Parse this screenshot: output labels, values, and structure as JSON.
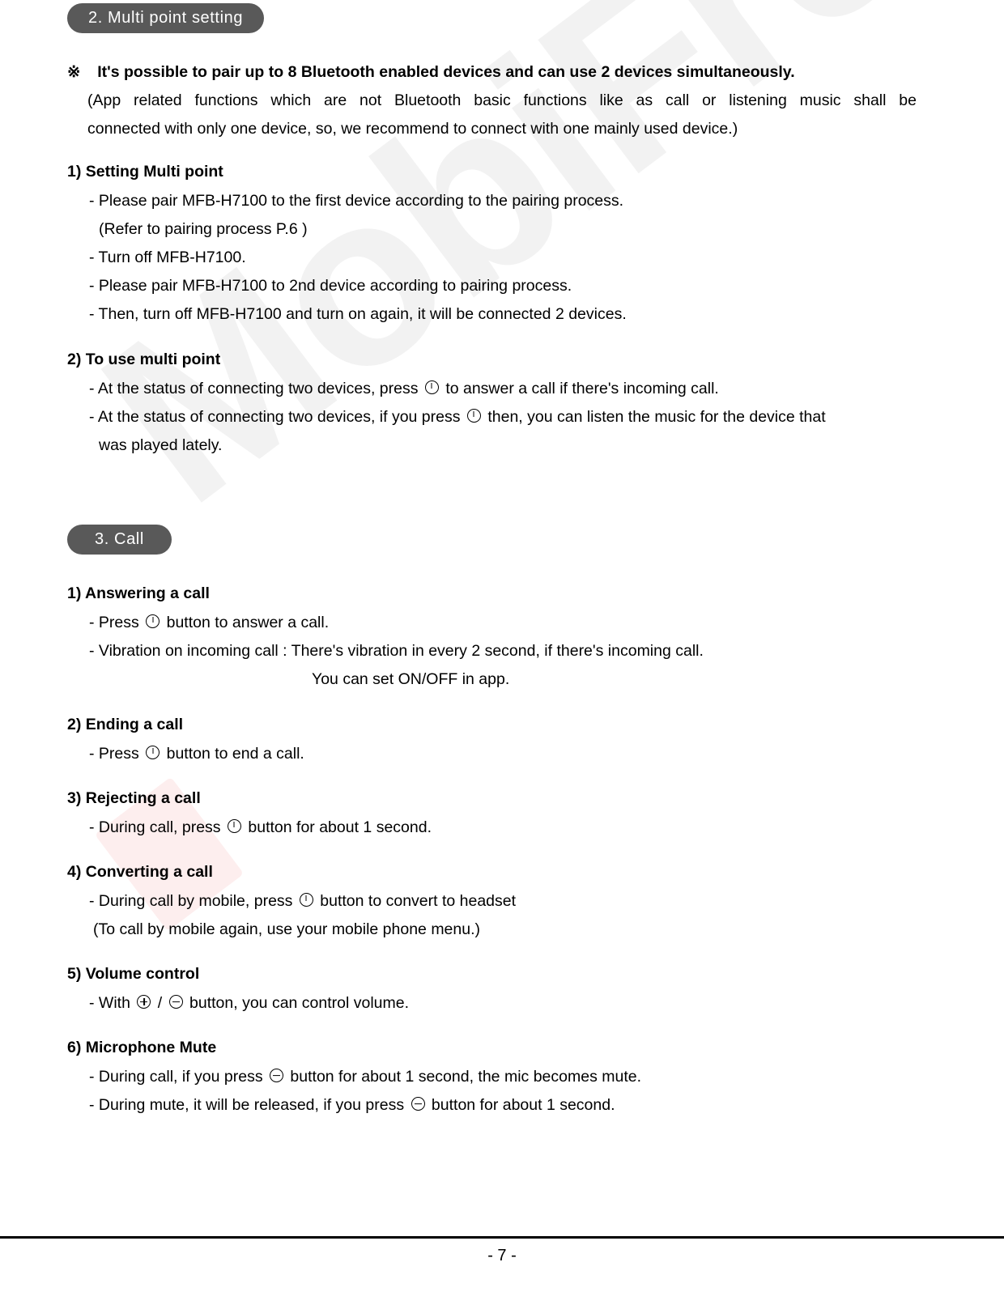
{
  "document": {
    "watermark": "MobiFren",
    "page_number": "- 7 -"
  },
  "sections": [
    {
      "tab_label": "2. Multi point setting",
      "note": {
        "marker": "※",
        "headline": "It's possible to pair up to 8 Bluetooth enabled devices and can use 2 devices simultaneously.",
        "paren_line1": "(App related functions which are not Bluetooth basic functions like as call or listening music shall be",
        "paren_line2": "connected with only one device, so, we recommend to connect with one mainly used device.)"
      },
      "items": [
        {
          "heading": "1) Setting Multi point",
          "lines": [
            "- Please pair MFB-H7100 to the first device according to the pairing process.",
            "(Refer to pairing process P.6 )",
            "- Turn off MFB-H7100.",
            "- Please pair MFB-H7100 to 2nd device according to pairing process.",
            "- Then, turn off MFB-H7100 and turn on again, it will be connected 2 devices."
          ]
        },
        {
          "heading": "2) To use multi point",
          "line1_a": "- At the status of connecting two devices, press",
          "line1_icon": "mfb-button-icon",
          "line1_b": "to answer a call if there's incoming call.",
          "line2_a": "- At the status of connecting two devices, if you press",
          "line2_icon": "mfb-button-icon",
          "line2_b": "then, you can listen the music for the device that",
          "line3": "was played lately."
        }
      ]
    },
    {
      "tab_label": "3. Call",
      "items": [
        {
          "heading": "1) Answering a call",
          "line1_a": "- Press",
          "line1_icon": "mfb-button-icon",
          "line1_b": "button to answer a call.",
          "line2": "- Vibration on incoming call : There's vibration in every 2 second, if there's incoming call.",
          "line3": "You can set ON/OFF in app."
        },
        {
          "heading": "2) Ending a call",
          "line1_a": "- Press",
          "line1_icon": "mfb-button-icon",
          "line1_b": "button to end a call."
        },
        {
          "heading": "3) Rejecting a call",
          "line1_a": "- During call, press",
          "line1_icon": "mfb-button-icon",
          "line1_b": "button for about 1 second."
        },
        {
          "heading": "4) Converting a call",
          "line1_a": "- During call by mobile, press",
          "line1_icon": "mfb-button-icon",
          "line1_b": "button to convert to headset",
          "line2": "(To call by mobile again, use your mobile phone menu.)"
        },
        {
          "heading": "5) Volume control",
          "line1_a": "- With",
          "line1_icon_plus": "volume-up-icon",
          "line1_sep": "/",
          "line1_icon_minus": "volume-down-icon",
          "line1_b": "button, you can control volume."
        },
        {
          "heading": "6) Microphone Mute",
          "line1_a": "- During call, if you press",
          "line1_icon": "volume-down-icon",
          "line1_b": "button for about 1 second, the mic becomes mute.",
          "line2_a": "- During mute, it will be released, if you press",
          "line2_icon": "volume-down-icon",
          "line2_b": "button for about 1 second."
        }
      ]
    }
  ]
}
